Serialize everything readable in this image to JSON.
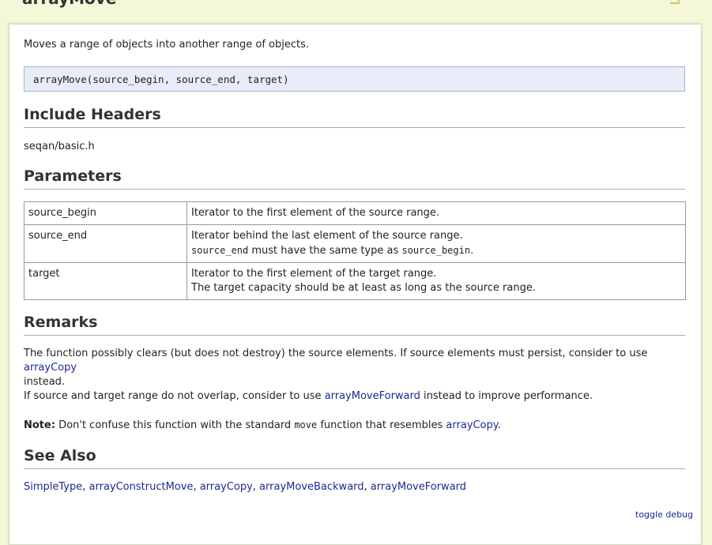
{
  "page": {
    "title": "arrayMove"
  },
  "summary": "Moves a range of objects into another range of objects.",
  "signature": "arrayMove(source_begin, source_end, target)",
  "include_headers": {
    "heading": "Include Headers",
    "path": "seqan/basic.h"
  },
  "parameters": {
    "heading": "Parameters",
    "rows": [
      {
        "name": "source_begin",
        "line1": "Iterator to the first element of the source range.",
        "line2": ""
      },
      {
        "name": "source_end",
        "line1": "Iterator behind the last element of the source range.",
        "line2_code1": "source_end",
        "line2_mid": " must have the same type as ",
        "line2_code2": "source_begin",
        "line2_end": "."
      },
      {
        "name": "target",
        "line1": "Iterator to the first element of the target range.",
        "line2": "The target capacity should be at least as long as the source range."
      }
    ]
  },
  "remarks": {
    "heading": "Remarks",
    "p1_text": "The function possibly clears (but does not destroy) the source elements. If source elements must persist, consider to use ",
    "p1_link": "arrayCopy",
    "p1_end": "instead.",
    "p2_text": "If source and target range do not overlap, consider to use ",
    "p2_link": "arrayMoveForward",
    "p2_end": " instead to improve performance.",
    "note_label": "Note:",
    "note_text": " Don't confuse this function with the standard ",
    "note_code": "move",
    "note_mid": " function that resembles ",
    "note_link": "arrayCopy",
    "note_end": "."
  },
  "see_also": {
    "heading": "See Also",
    "links": [
      "SimpleType",
      "arrayConstructMove",
      "arrayCopy",
      "arrayMoveBackward",
      "arrayMoveForward"
    ],
    "separator": ", "
  },
  "footer": {
    "toggle_debug": "toggle debug"
  },
  "colors": {
    "page_background": "#f4f8d8",
    "link": "#1a2a8c",
    "signature_background": "#e6ecf8"
  }
}
